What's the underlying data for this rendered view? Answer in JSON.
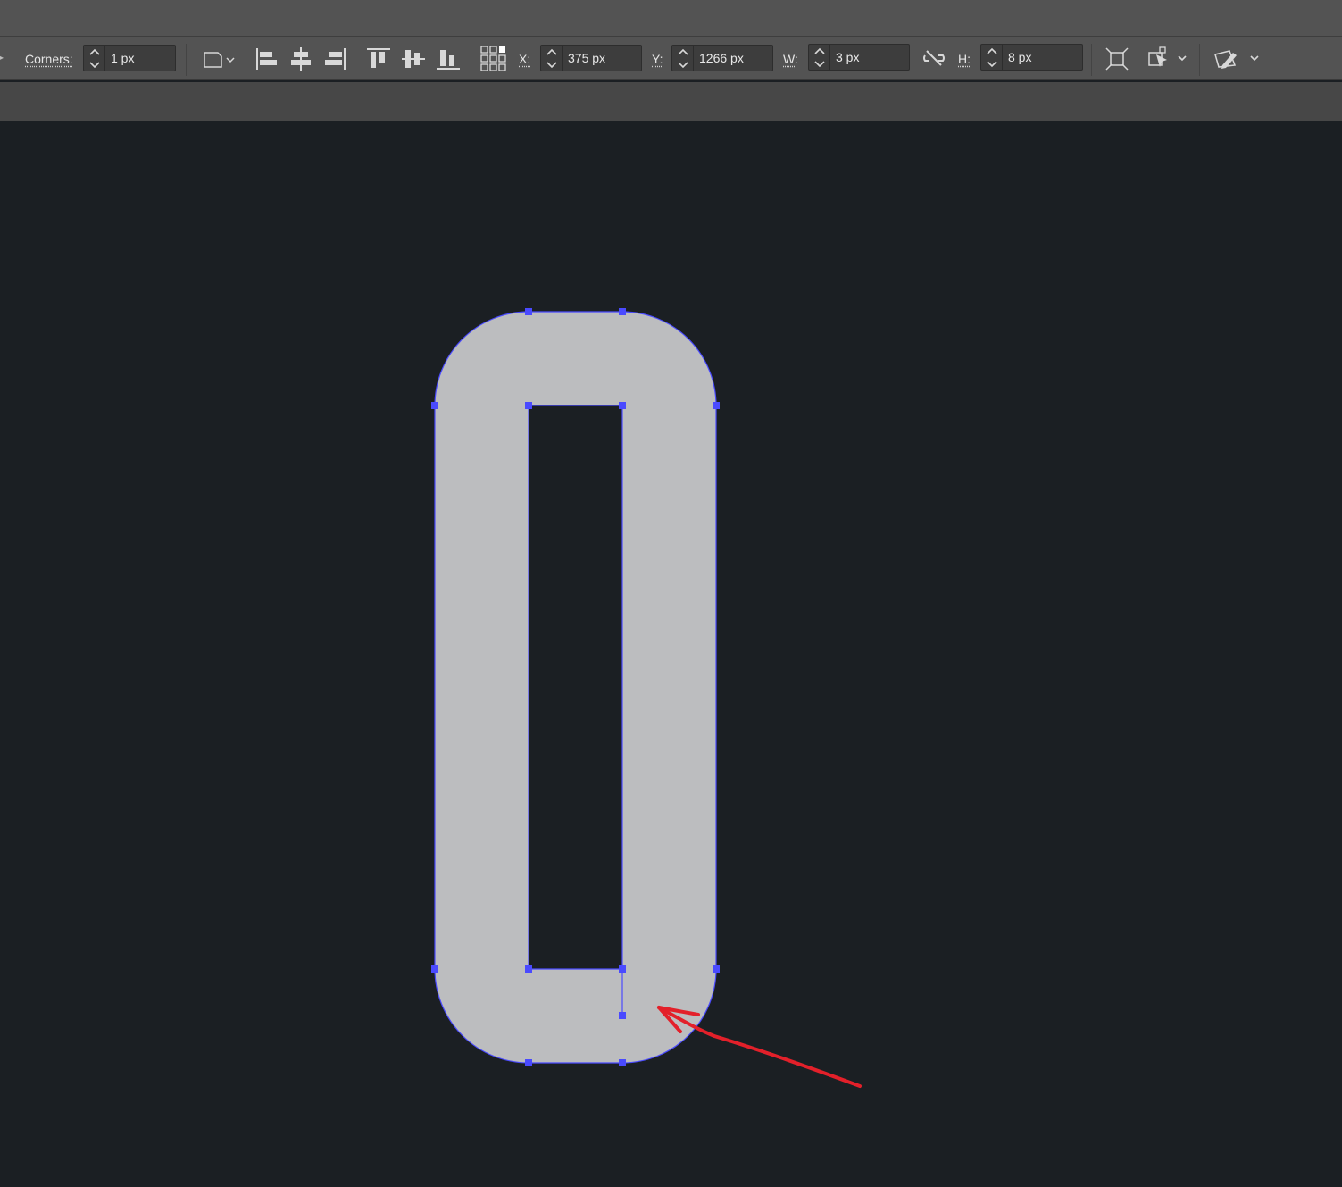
{
  "toolbar": {
    "corners": {
      "label": "Corners:",
      "value": "1 px"
    },
    "x": {
      "label": "X:",
      "value": "375 px"
    },
    "y": {
      "label": "Y:",
      "value": "1266 px"
    },
    "w": {
      "label": "W:",
      "value": "3 px"
    },
    "h": {
      "label": "H:",
      "value": "8 px"
    },
    "tools": [
      "shape-options-dropdown-icon",
      "align-left-icon",
      "align-horizontal-center-icon",
      "align-right-icon",
      "align-top-icon",
      "align-vertical-center-icon",
      "align-bottom-icon",
      "reference-point-grid-icon",
      "unlink-proportions-icon",
      "transform-icon",
      "isolate-selection-icon",
      "edit-path-icon"
    ]
  },
  "colors": {
    "app_bar": "#535353",
    "sub_bar": "#474747",
    "canvas": "#1b1f23",
    "shape_fill": "#bcbdbf",
    "selection": "#4a4aff",
    "annotation_arrow": "#e3202a"
  }
}
